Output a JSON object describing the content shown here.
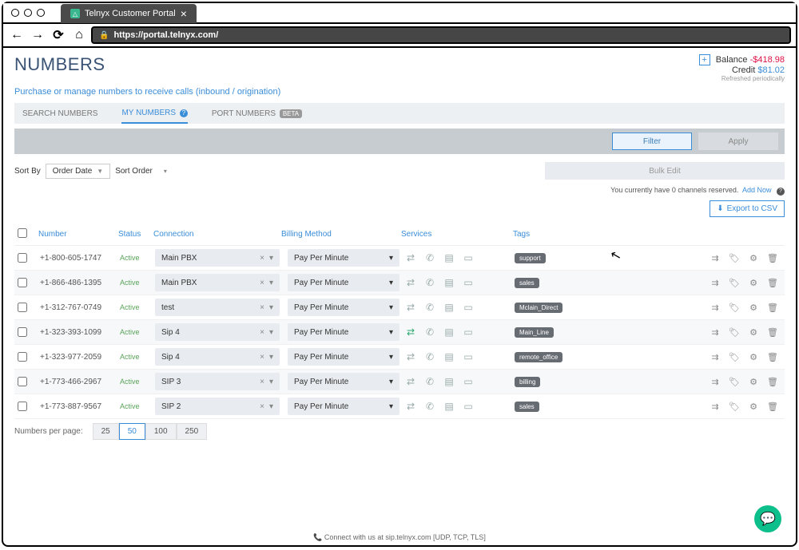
{
  "browser": {
    "tab_title": "Telnyx Customer Portal",
    "url": "https://portal.telnyx.com/"
  },
  "header": {
    "title": "NUMBERS",
    "subtitle": "Purchase or manage numbers to receive calls (inbound / origination)",
    "balance_label": "Balance",
    "balance_value": "-$418.98",
    "credit_label": "Credit",
    "credit_value": "$81.02",
    "refresh_note": "Refreshed periodically"
  },
  "tabs": {
    "search": "SEARCH NUMBERS",
    "my": "MY NUMBERS",
    "port": "PORT NUMBERS",
    "port_badge": "BETA"
  },
  "filters": {
    "filter_btn": "Filter",
    "apply_btn": "Apply"
  },
  "sort": {
    "label": "Sort By",
    "field": "Order Date",
    "order_label": "Sort Order"
  },
  "bulk_edit": "Bulk Edit",
  "channels": {
    "text": "You currently have 0 channels reserved.",
    "link": "Add Now"
  },
  "export_btn": "Export to CSV",
  "columns": {
    "number": "Number",
    "status": "Status",
    "connection": "Connection",
    "billing": "Billing Method",
    "services": "Services",
    "tags": "Tags"
  },
  "rows": [
    {
      "number": "+1-800-605-1747",
      "status": "Active",
      "connection": "Main PBX",
      "billing": "Pay Per Minute",
      "tag": "support",
      "svc_on": false
    },
    {
      "number": "+1-866-486-1395",
      "status": "Active",
      "connection": "Main PBX",
      "billing": "Pay Per Minute",
      "tag": "sales",
      "svc_on": false
    },
    {
      "number": "+1-312-767-0749",
      "status": "Active",
      "connection": "test",
      "billing": "Pay Per Minute",
      "tag": "Mclain_Direct",
      "svc_on": false
    },
    {
      "number": "+1-323-393-1099",
      "status": "Active",
      "connection": "Sip 4",
      "billing": "Pay Per Minute",
      "tag": "Main_Line",
      "svc_on": true
    },
    {
      "number": "+1-323-977-2059",
      "status": "Active",
      "connection": "Sip 4",
      "billing": "Pay Per Minute",
      "tag": "remote_office",
      "svc_on": false
    },
    {
      "number": "+1-773-466-2967",
      "status": "Active",
      "connection": "SIP 3",
      "billing": "Pay Per Minute",
      "tag": "billing",
      "svc_on": false
    },
    {
      "number": "+1-773-887-9567",
      "status": "Active",
      "connection": "SIP 2",
      "billing": "Pay Per Minute",
      "tag": "sales",
      "svc_on": false
    }
  ],
  "pager": {
    "label": "Numbers per page:",
    "options": [
      "25",
      "50",
      "100",
      "250"
    ],
    "active": "50"
  },
  "footer": {
    "text": "Connect with us at sip.telnyx.com [UDP, TCP, TLS]"
  }
}
